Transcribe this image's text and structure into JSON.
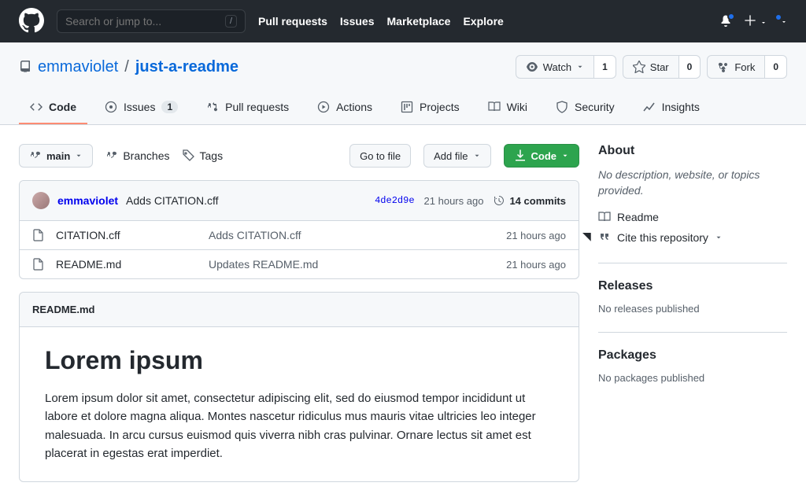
{
  "topnav": {
    "search_placeholder": "Search or jump to...",
    "links": [
      "Pull requests",
      "Issues",
      "Marketplace",
      "Explore"
    ]
  },
  "repo": {
    "owner": "emmaviolet",
    "name": "just-a-readme"
  },
  "repo_actions": {
    "watch_label": "Watch",
    "watch_count": "1",
    "star_label": "Star",
    "star_count": "0",
    "fork_label": "Fork",
    "fork_count": "0"
  },
  "tabs": {
    "code": "Code",
    "issues": "Issues",
    "issues_count": "1",
    "pulls": "Pull requests",
    "actions": "Actions",
    "projects": "Projects",
    "wiki": "Wiki",
    "security": "Security",
    "insights": "Insights"
  },
  "filebar": {
    "branch_label": "main",
    "branches": "Branches",
    "tags": "Tags",
    "goto": "Go to file",
    "addfile": "Add file",
    "code": "Code"
  },
  "commitbar": {
    "author": "emmaviolet",
    "message": "Adds CITATION.cff",
    "sha": "4de2d9e",
    "when": "21 hours ago",
    "commits_count": "14",
    "commits_label": "commits"
  },
  "files": [
    {
      "name": "CITATION.cff",
      "msg": "Adds CITATION.cff",
      "when": "21 hours ago"
    },
    {
      "name": "README.md",
      "msg": "Updates README.md",
      "when": "21 hours ago"
    }
  ],
  "readme": {
    "filename": "README.md",
    "title": "Lorem ipsum",
    "body": "Lorem ipsum dolor sit amet, consectetur adipiscing elit, sed do eiusmod tempor incididunt ut labore et dolore magna aliqua. Montes nascetur ridiculus mus mauris vitae ultricies leo integer malesuada. In arcu cursus euismod quis viverra nibh cras pulvinar. Ornare lectus sit amet est placerat in egestas erat imperdiet."
  },
  "about": {
    "heading": "About",
    "description": "No description, website, or topics provided.",
    "readme_link": "Readme",
    "cite_link": "Cite this repository"
  },
  "releases": {
    "heading": "Releases",
    "empty": "No releases published"
  },
  "packages": {
    "heading": "Packages",
    "empty": "No packages published"
  }
}
